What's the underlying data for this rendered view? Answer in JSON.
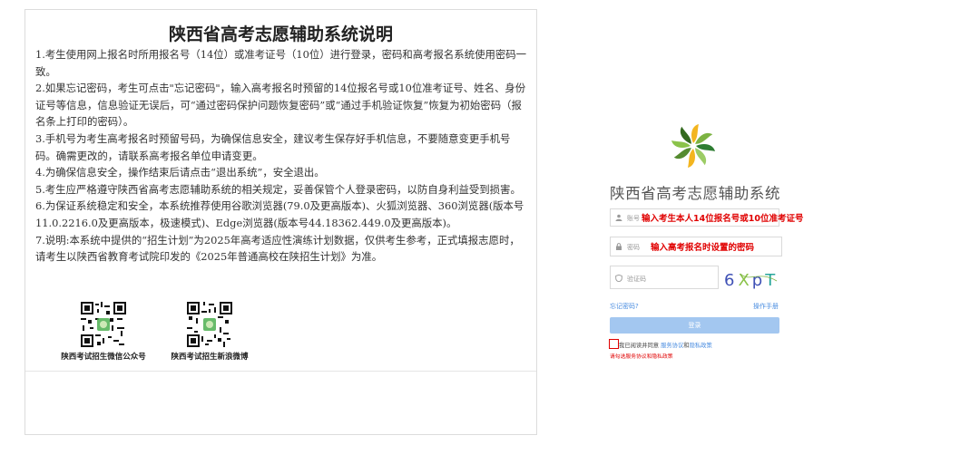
{
  "notice": {
    "title": "陕西省高考志愿辅助系统说明",
    "paragraphs": [
      "1.考生使用网上报名时所用报名号（14位）或准考证号（10位）进行登录，密码和高考报名系统使用密码一致。",
      "2.如果忘记密码，考生可点击\"忘记密码\"，输入高考报名时预留的14位报名号或10位准考证号、姓名、身份证号等信息，信息验证无误后，可“通过密码保护问题恢复密码”或“通过手机验证恢复”恢复为初始密码（报名条上打印的密码）。",
      "3.手机号为考生高考报名时预留号码，为确保信息安全，建议考生保存好手机信息，不要随意变更手机号码。确需更改的，请联系高考报名单位申请变更。",
      "4.为确保信息安全，操作结束后请点击“退出系统”，安全退出。",
      "5.考生应严格遵守陕西省高考志愿辅助系统的相关规定，妥善保管个人登录密码，以防自身利益受到损害。",
      "6.为保证系统稳定和安全，本系统推荐使用谷歌浏览器(79.0及更高版本)、火狐浏览器、360浏览器(版本号11.0.2216.0及更高版本，极速模式)、Edge浏览器(版本号44.18362.449.0及更高版本)。",
      "7.说明:本系统中提供的“招生计划”为2025年高考适应性演练计划数据，仅供考生参考，正式填报志愿时，请考生以陕西省教育考试院印发的《2025年普通高校在陕招生计划》为准。"
    ],
    "qr_wechat_caption": "陕西考试招生微信公众号",
    "qr_weibo_caption": "陕西考试招生新浪微博"
  },
  "login": {
    "system_title": "陕西省高考志愿辅助系统",
    "account_placeholder": "账号",
    "password_placeholder": "密码",
    "captcha_placeholder": "验证码",
    "captcha_text": "6XpT",
    "account_annotation": "输入考生本人14位报名号或10位准考证号",
    "password_annotation": "输入高考报名时设置的密码",
    "forgot_password": "忘记密码?",
    "manual": "操作手册",
    "login_button": "登录",
    "agree_text": "我已阅读并同意",
    "service_agreement": "服务协议",
    "and": "和",
    "privacy_policy": "隐私政策",
    "agree_warning": "请勾选服务协议和隐私政策"
  },
  "colors": {
    "annotation_red": "#e00000",
    "link_blue": "#4a8de0",
    "login_button": "#a3c7f0"
  },
  "icons": [
    "user-icon",
    "lock-icon",
    "shield-icon",
    "logo-pinwheel-icon",
    "qr-code-icon"
  ]
}
